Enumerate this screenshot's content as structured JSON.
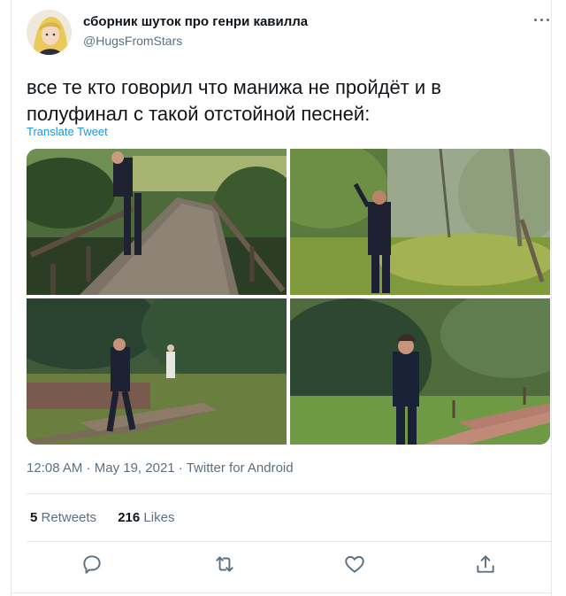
{
  "author": {
    "display_name": "сборник шуток про генри кавилла",
    "username": "@HugsFromStars",
    "avatar_icon": "avatar-illustration"
  },
  "tweet": {
    "text": "все те кто говорил что манижа не пройдёт и в\nполуфинал с такой отстойной песней:",
    "translate_label": "Translate Tweet"
  },
  "meta": {
    "time": "12:08 AM",
    "separator": " · ",
    "date": "May 19, 2021",
    "source": "Twitter for Android"
  },
  "stats": {
    "retweets_count": "5",
    "retweets_label": "Retweets",
    "likes_count": "216",
    "likes_label": "Likes"
  },
  "actions": [
    "reply-icon",
    "retweet-icon",
    "like-icon",
    "share-icon"
  ],
  "colors": {
    "link": "#1b95e0",
    "secondary_text": "#5b7083",
    "primary_text": "#0f1419",
    "divider": "#e6e9ec"
  }
}
